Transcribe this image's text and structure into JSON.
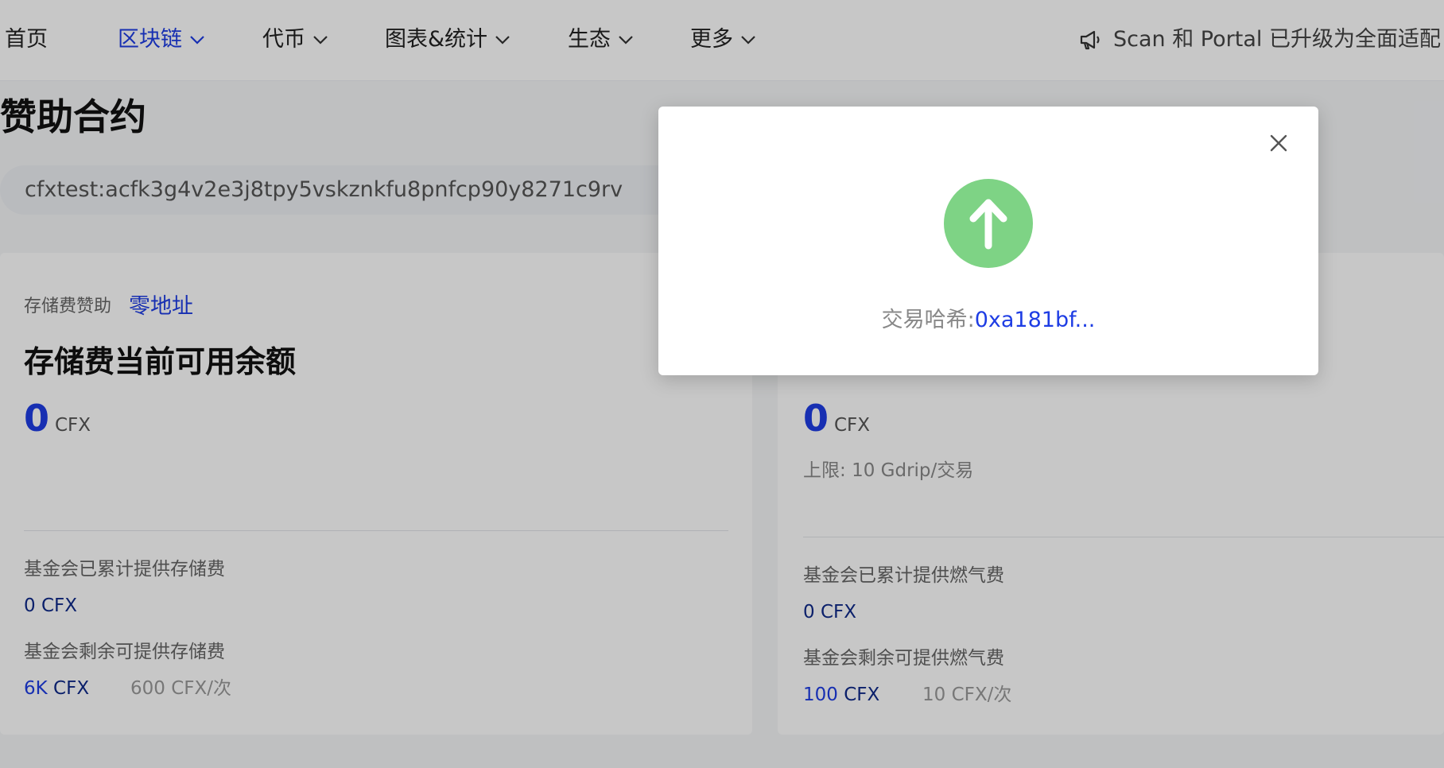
{
  "nav": {
    "items": [
      {
        "label": "首页",
        "has_dropdown": false,
        "active": false
      },
      {
        "label": "区块链",
        "has_dropdown": true,
        "active": true
      },
      {
        "label": "代币",
        "has_dropdown": true,
        "active": false
      },
      {
        "label": "图表&统计",
        "has_dropdown": true,
        "active": false
      },
      {
        "label": "生态",
        "has_dropdown": true,
        "active": false
      },
      {
        "label": "更多",
        "has_dropdown": true,
        "active": false
      }
    ],
    "announcement": "Scan 和 Portal 已升级为全面适配"
  },
  "page": {
    "title": "赞助合约",
    "address": "cfxtest:acfk3g4v2e3j8tpy5vskznkfu8pnfcp90y8271c9rv"
  },
  "storage_card": {
    "sponsor_label": "存储费赞助",
    "sponsor_value": "零地址",
    "heading": "存储费当前可用余额",
    "balance": "0",
    "balance_unit": "CFX",
    "provided_label": "基金会已累计提供存储费",
    "provided_value": "0 CFX",
    "remaining_label": "基金会剩余可提供存储费",
    "remaining_amount": "6K",
    "remaining_unit": "CFX",
    "per_tx": "600 CFX/次"
  },
  "gas_card": {
    "balance": "0",
    "balance_unit": "CFX",
    "limit_label": "上限:",
    "limit_value": "10",
    "limit_unit": "Gdrip/交易",
    "provided_label": "基金会已累计提供燃气费",
    "provided_value": "0 CFX",
    "remaining_label": "基金会剩余可提供燃气费",
    "remaining_amount": "100",
    "remaining_unit": "CFX",
    "per_tx": "10 CFX/次"
  },
  "modal": {
    "tx_label": "交易哈希:",
    "tx_hash": "0xa181bf..."
  },
  "colors": {
    "accent": "#1e3de4",
    "success": "#7ed385",
    "overlay": "rgba(0,0,0,0.22)"
  },
  "icons": {
    "announce": "megaphone-icon",
    "dropdown": "chevron-down-icon",
    "close": "close-icon",
    "success": "arrow-up-circle-icon"
  }
}
